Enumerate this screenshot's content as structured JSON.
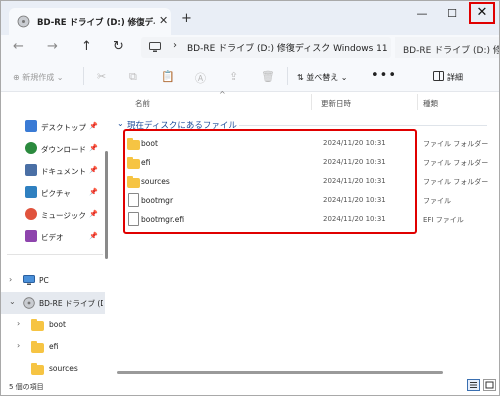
{
  "window": {
    "tab_title": "BD-RE ドライブ (D:) 修復ディスク W",
    "new_tab": "+",
    "minimize": "—",
    "maximize": "☐",
    "close": "✕"
  },
  "nav": {
    "back": "←",
    "forward": "→",
    "up": "↑",
    "refresh": "↻"
  },
  "address": {
    "chevron": "›",
    "path": "BD-RE ドライブ (D:) 修復ディスク Windows 11",
    "search_placeholder": "BD-RE ドライブ (D:) 修復"
  },
  "toolbar": {
    "new_label": "⊕ 新規作成 ⌄",
    "sort_label": "⇅ 並べ替え ⌄",
    "more_label": "•••",
    "details_label": "詳細"
  },
  "sidebar": {
    "quick_access": [
      {
        "label": "デスクトップ",
        "icon": "desktop-icon",
        "color": "#3a7bd5"
      },
      {
        "label": "ダウンロード",
        "icon": "download-icon",
        "color": "#2b8a3e"
      },
      {
        "label": "ドキュメント",
        "icon": "document-icon",
        "color": "#4a6fa5"
      },
      {
        "label": "ピクチャ",
        "icon": "picture-icon",
        "color": "#2f80c0"
      },
      {
        "label": "ミュージック",
        "icon": "music-icon",
        "color": "#e0533d"
      },
      {
        "label": "ビデオ",
        "icon": "video-icon",
        "color": "#8e44ad"
      }
    ],
    "pin": "📌",
    "tree": [
      {
        "label": "PC",
        "expand": "›"
      },
      {
        "label": "BD-RE ドライブ (D:)",
        "expand": "⌄"
      },
      {
        "label": "boot",
        "expand": "›"
      },
      {
        "label": "efi",
        "expand": "›"
      },
      {
        "label": "sources",
        "expand": ""
      }
    ]
  },
  "columns": {
    "name": "名前",
    "modified": "更新日時",
    "type": "種類"
  },
  "group": {
    "chevron": "⌄",
    "title": "現在ディスクにあるファイル"
  },
  "files": [
    {
      "name": "boot",
      "date": "2024/11/20 10:31",
      "type": "ファイル フォルダー",
      "kind": "folder"
    },
    {
      "name": "efi",
      "date": "2024/11/20 10:31",
      "type": "ファイル フォルダー",
      "kind": "folder"
    },
    {
      "name": "sources",
      "date": "2024/11/20 10:31",
      "type": "ファイル フォルダー",
      "kind": "folder"
    },
    {
      "name": "bootmgr",
      "date": "2024/11/20 10:31",
      "type": "ファイル",
      "kind": "file"
    },
    {
      "name": "bootmgr.efi",
      "date": "2024/11/20 10:31",
      "type": "EFI ファイル",
      "kind": "file"
    }
  ],
  "status": {
    "count": "5 個の項目"
  }
}
